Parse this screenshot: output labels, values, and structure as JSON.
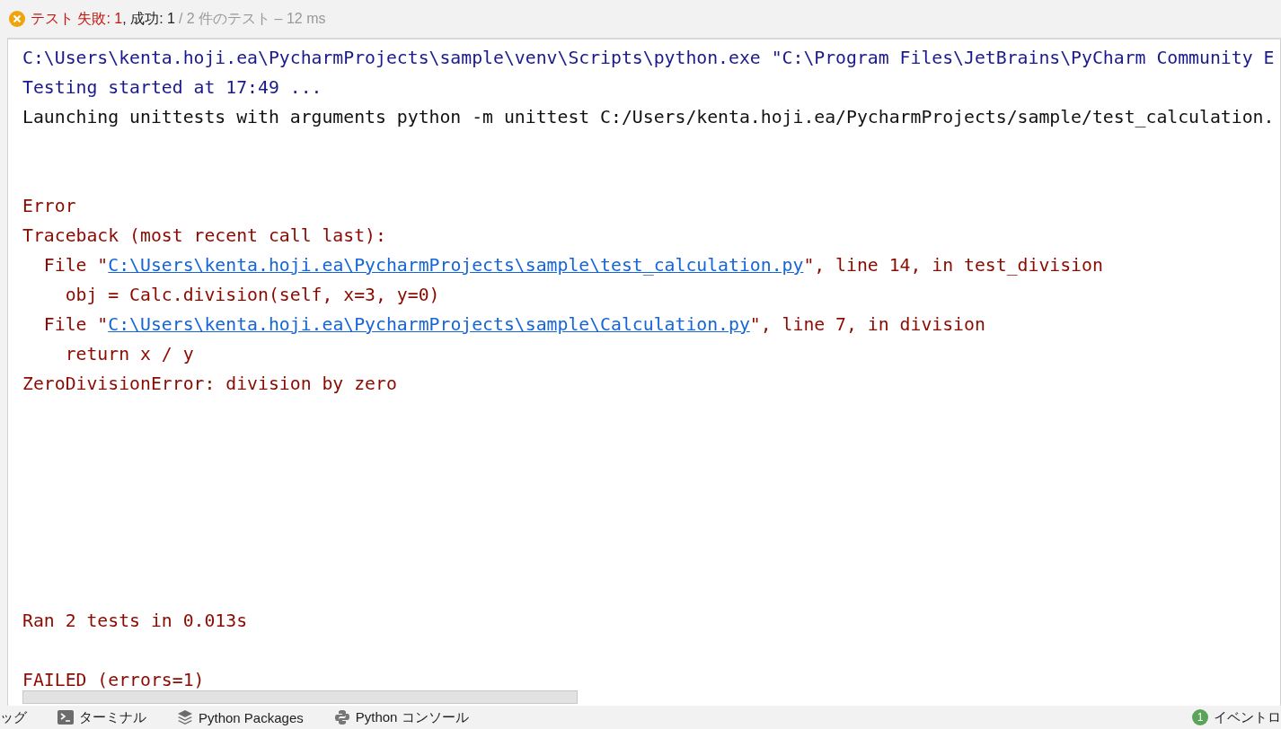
{
  "status": {
    "parts": [
      {
        "text": "テスト 失敗: 1",
        "kind": "failed"
      },
      {
        "text": ", 成功: 1",
        "kind": "passed"
      },
      {
        "text": "/ 2 件のテスト – 12 ms",
        "kind": "summary"
      }
    ]
  },
  "console": {
    "lines": [
      {
        "kind": "command",
        "parts": [
          {
            "text": "C:\\Users\\kenta.hoji.ea\\PycharmProjects\\sample\\venv\\Scripts\\python.exe \"C:\\Program Files\\JetBrains\\PyCharm Community E",
            "link": false
          }
        ]
      },
      {
        "kind": "command",
        "parts": [
          {
            "text": "Testing started at 17:49 ...",
            "link": false
          }
        ]
      },
      {
        "kind": "normal",
        "parts": [
          {
            "text": "Launching unittests with arguments python -m unittest C:/Users/kenta.hoji.ea/PycharmProjects/sample/test_calculation.",
            "link": false
          }
        ]
      },
      {
        "kind": "blank"
      },
      {
        "kind": "blank"
      },
      {
        "kind": "error",
        "parts": [
          {
            "text": "Error",
            "link": false
          }
        ]
      },
      {
        "kind": "error",
        "parts": [
          {
            "text": "Traceback (most recent call last):",
            "link": false
          }
        ]
      },
      {
        "kind": "error",
        "parts": [
          {
            "text": "  File \"",
            "link": false
          },
          {
            "text": "C:\\Users\\kenta.hoji.ea\\PycharmProjects\\sample\\test_calculation.py",
            "link": true
          },
          {
            "text": "\", line 14, in test_division",
            "link": false
          }
        ]
      },
      {
        "kind": "error",
        "parts": [
          {
            "text": "    obj = Calc.division(self, x=3, y=0)",
            "link": false
          }
        ]
      },
      {
        "kind": "error",
        "parts": [
          {
            "text": "  File \"",
            "link": false
          },
          {
            "text": "C:\\Users\\kenta.hoji.ea\\PycharmProjects\\sample\\Calculation.py",
            "link": true
          },
          {
            "text": "\", line 7, in division",
            "link": false
          }
        ]
      },
      {
        "kind": "error",
        "parts": [
          {
            "text": "    return x / y",
            "link": false
          }
        ]
      },
      {
        "kind": "error",
        "parts": [
          {
            "text": "ZeroDivisionError: division by zero",
            "link": false
          }
        ]
      },
      {
        "kind": "blank"
      },
      {
        "kind": "blank"
      },
      {
        "kind": "blank"
      },
      {
        "kind": "blank"
      },
      {
        "kind": "blank"
      },
      {
        "kind": "blank"
      },
      {
        "kind": "blank"
      },
      {
        "kind": "error",
        "parts": [
          {
            "text": "Ran 2 tests in 0.013s",
            "link": false
          }
        ]
      },
      {
        "kind": "blank"
      },
      {
        "kind": "error",
        "parts": [
          {
            "text": "FAILED (errors=1)",
            "link": false
          }
        ]
      }
    ]
  },
  "tool_tabs": [
    {
      "label": "ッグ",
      "kind": "debug"
    },
    {
      "label": "ターミナル",
      "kind": "terminal"
    },
    {
      "label": "Python Packages",
      "kind": "packages"
    },
    {
      "label": "Python コンソール",
      "kind": "console"
    }
  ],
  "event_log": {
    "badge": "1",
    "label": "イベントロ"
  }
}
